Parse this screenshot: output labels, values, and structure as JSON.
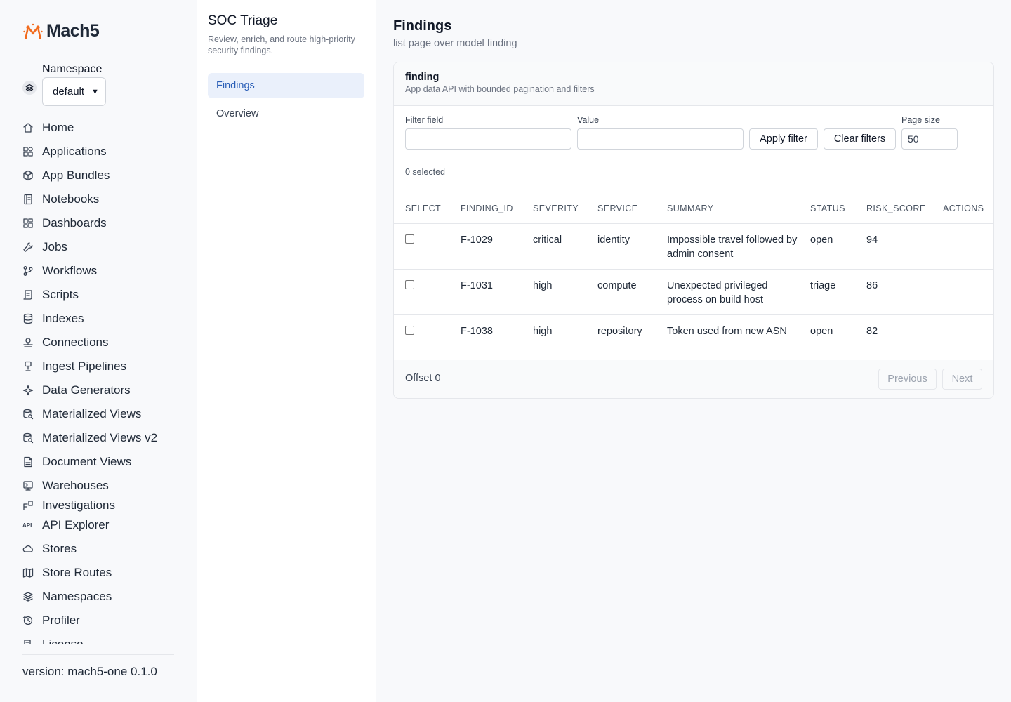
{
  "brand": {
    "name": "Mach5",
    "accent": "#f26b1d"
  },
  "namespace": {
    "label": "Namespace",
    "selected": "default"
  },
  "sidebar": {
    "items": [
      {
        "label": "Home",
        "icon": "home-icon"
      },
      {
        "label": "Applications",
        "icon": "apps-icon"
      },
      {
        "label": "App Bundles",
        "icon": "package-icon"
      },
      {
        "label": "Notebooks",
        "icon": "notebook-icon"
      },
      {
        "label": "Dashboards",
        "icon": "dashboard-icon"
      },
      {
        "label": "Jobs",
        "icon": "wrench-icon"
      },
      {
        "label": "Workflows",
        "icon": "workflow-icon"
      },
      {
        "label": "Scripts",
        "icon": "script-icon"
      },
      {
        "label": "Indexes",
        "icon": "database-icon"
      },
      {
        "label": "Connections",
        "icon": "connection-icon"
      },
      {
        "label": "Ingest Pipelines",
        "icon": "pipeline-icon"
      },
      {
        "label": "Data Generators",
        "icon": "sparkle-icon"
      },
      {
        "label": "Materialized Views",
        "icon": "view-icon"
      },
      {
        "label": "Materialized Views v2",
        "icon": "view-v2-icon"
      },
      {
        "label": "Document Views",
        "icon": "document-icon"
      },
      {
        "label": "Warehouses",
        "icon": "warehouse-icon"
      },
      {
        "label": "Investigations",
        "icon": "investigation-icon"
      },
      {
        "label": "API Explorer",
        "icon": "api-icon"
      },
      {
        "label": "Stores",
        "icon": "cloud-icon"
      },
      {
        "label": "Store Routes",
        "icon": "map-icon"
      },
      {
        "label": "Namespaces",
        "icon": "layers-icon"
      },
      {
        "label": "Profiler",
        "icon": "profiler-icon"
      },
      {
        "label": "License",
        "icon": "license-icon"
      }
    ],
    "version": "version: mach5-one 0.1.0"
  },
  "panel": {
    "title": "SOC Triage",
    "subtitle": "Review, enrich, and route high-priority security findings.",
    "items": [
      {
        "label": "Findings",
        "active": true
      },
      {
        "label": "Overview",
        "active": false
      }
    ]
  },
  "main": {
    "title": "Findings",
    "subtitle": "list page over model finding",
    "card": {
      "title": "finding",
      "subtitle": "App data API with bounded pagination and filters"
    },
    "filters": {
      "field_label": "Filter field",
      "field_value": "",
      "value_label": "Value",
      "value_value": "",
      "apply_label": "Apply filter",
      "clear_label": "Clear filters",
      "page_size_label": "Page size",
      "page_size_value": "50",
      "selected_text": "0 selected"
    },
    "table": {
      "columns": [
        "SELECT",
        "FINDING_ID",
        "SEVERITY",
        "SERVICE",
        "SUMMARY",
        "STATUS",
        "RISK_SCORE",
        "ACTIONS"
      ],
      "rows": [
        {
          "finding_id": "F-1029",
          "severity": "critical",
          "service": "identity",
          "summary": "Impossible travel followed by admin consent",
          "status": "open",
          "risk_score": "94",
          "checked": false
        },
        {
          "finding_id": "F-1031",
          "severity": "high",
          "service": "compute",
          "summary": "Unexpected privileged process on build host",
          "status": "triage",
          "risk_score": "86",
          "checked": false
        },
        {
          "finding_id": "F-1038",
          "severity": "high",
          "service": "repository",
          "summary": "Token used from new ASN",
          "status": "open",
          "risk_score": "82",
          "checked": false
        }
      ]
    },
    "footer": {
      "offset": "Offset 0",
      "previous": "Previous",
      "next": "Next"
    }
  }
}
